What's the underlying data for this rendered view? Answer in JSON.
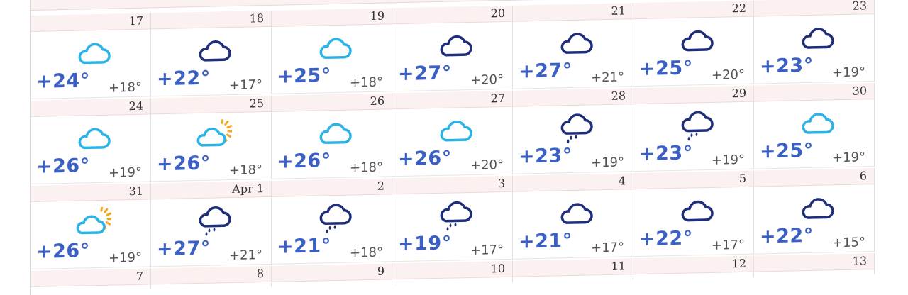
{
  "colors": {
    "header_bg": "#fbf1f1",
    "temp_high": "#3a5fc5",
    "temp_low": "#555555",
    "cloud_light": "#29b3e6",
    "cloud_dark": "#1f2e7a",
    "sun": "#f5a623"
  },
  "weeks": [
    {
      "days": [
        {
          "date": "17",
          "icon": "cloud-light-icon",
          "high": "+24°",
          "low": "+18°"
        },
        {
          "date": "18",
          "icon": "cloud-dark-icon",
          "high": "+22°",
          "low": "+17°"
        },
        {
          "date": "19",
          "icon": "cloud-light-icon",
          "high": "+25°",
          "low": "+18°"
        },
        {
          "date": "20",
          "icon": "cloud-dark-icon",
          "high": "+27°",
          "low": "+20°"
        },
        {
          "date": "21",
          "icon": "cloud-dark-icon",
          "high": "+27°",
          "low": "+21°"
        },
        {
          "date": "22",
          "icon": "cloud-dark-icon",
          "high": "+25°",
          "low": "+20°"
        },
        {
          "date": "23",
          "icon": "cloud-dark-icon",
          "high": "+23°",
          "low": "+19°"
        }
      ]
    },
    {
      "days": [
        {
          "date": "24",
          "icon": "cloud-light-icon",
          "high": "+26°",
          "low": "+19°"
        },
        {
          "date": "25",
          "icon": "partly-sunny-icon",
          "high": "+26°",
          "low": "+18°"
        },
        {
          "date": "26",
          "icon": "cloud-light-icon",
          "high": "+26°",
          "low": "+18°"
        },
        {
          "date": "27",
          "icon": "cloud-light-icon",
          "high": "+26°",
          "low": "+20°"
        },
        {
          "date": "28",
          "icon": "rain-cloud-icon",
          "high": "+23°",
          "low": "+19°"
        },
        {
          "date": "29",
          "icon": "rain-cloud-icon",
          "high": "+23°",
          "low": "+19°"
        },
        {
          "date": "30",
          "icon": "cloud-light-icon",
          "high": "+25°",
          "low": "+19°"
        }
      ]
    },
    {
      "days": [
        {
          "date": "31",
          "icon": "partly-sunny-icon",
          "high": "+26°",
          "low": "+19°"
        },
        {
          "date": "Apr 1",
          "icon": "rain-cloud-icon",
          "high": "+27°",
          "low": "+21°"
        },
        {
          "date": "2",
          "icon": "rain-cloud-icon",
          "high": "+21°",
          "low": "+18°"
        },
        {
          "date": "3",
          "icon": "rain-cloud-icon",
          "high": "+19°",
          "low": "+17°"
        },
        {
          "date": "4",
          "icon": "cloud-dark-icon",
          "high": "+21°",
          "low": "+17°"
        },
        {
          "date": "5",
          "icon": "cloud-dark-icon",
          "high": "+22°",
          "low": "+17°"
        },
        {
          "date": "6",
          "icon": "cloud-dark-icon",
          "high": "+22°",
          "low": "+15°"
        }
      ]
    }
  ],
  "next_week_dates": [
    "7",
    "8",
    "9",
    "10",
    "11",
    "12",
    "13"
  ]
}
